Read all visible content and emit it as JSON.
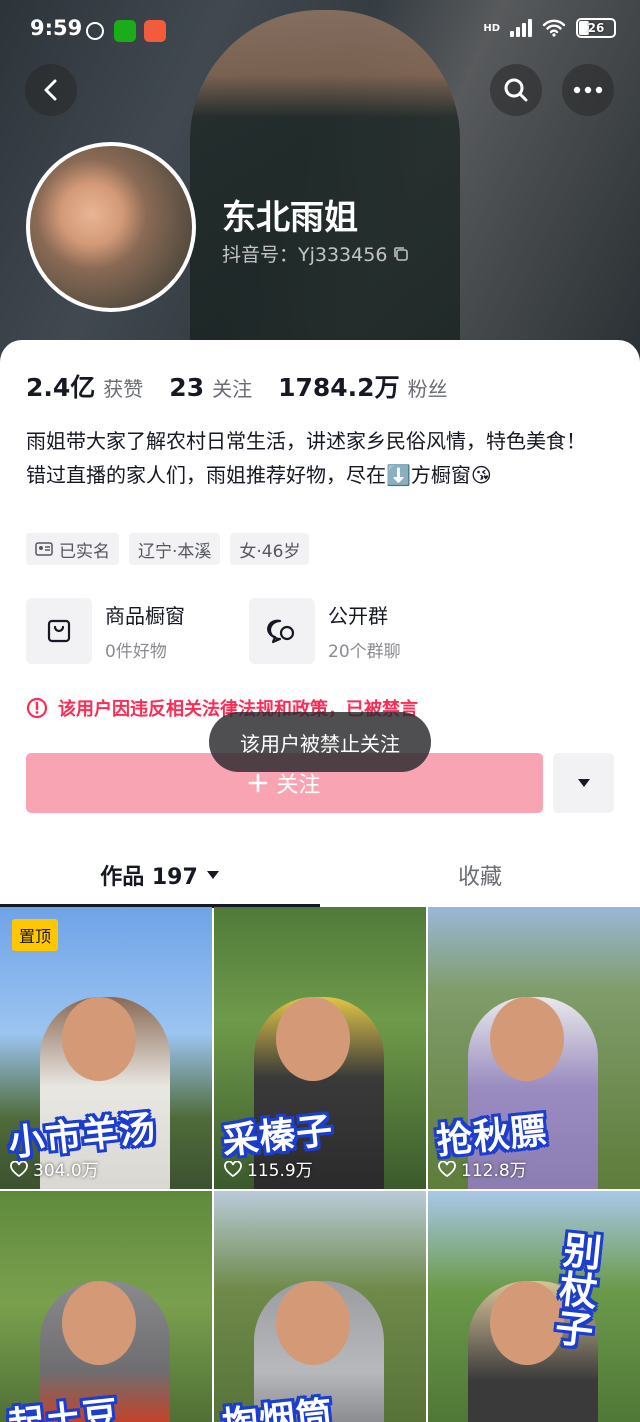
{
  "status_bar": {
    "time": "9:59",
    "network": "HD",
    "battery": "26"
  },
  "profile": {
    "name": "东北雨姐",
    "douyin_id": "抖音号：Yj333456",
    "stats": [
      {
        "value": "2.4亿",
        "label": "获赞"
      },
      {
        "value": "23",
        "label": "关注"
      },
      {
        "value": "1784.2万",
        "label": "粉丝"
      }
    ],
    "bio_line1": "雨姐带大家了解农村日常生活，讲述家乡民俗风情，特色美食！",
    "bio_line2": "错过直播的家人们，雨姐推荐好物，尽在⬇️方橱窗😘",
    "tags": [
      "已实名",
      "辽宁·本溪",
      "女·46岁"
    ]
  },
  "cards": [
    {
      "title": "商品橱窗",
      "sub": "0件好物",
      "icon": "shopping-bag-icon"
    },
    {
      "title": "公开群",
      "sub": "20个群聊",
      "icon": "group-chat-icon"
    }
  ],
  "warning": "该用户因违反相关法律法规和政策，已被禁言",
  "follow_label": "关注",
  "toast": "该用户被禁止关注",
  "tabs": {
    "works": "作品 197",
    "favorites": "收藏"
  },
  "videos": [
    {
      "title": "小市羊汤",
      "likes": "304.0万",
      "pinned": true,
      "pin_label": "置顶"
    },
    {
      "title": "采榛子",
      "likes": "115.9万"
    },
    {
      "title": "抢秋膘",
      "likes": "112.8万"
    },
    {
      "title": "起土豆",
      "likes": ""
    },
    {
      "title": "掏烟筒",
      "likes": ""
    },
    {
      "title": "别杖子",
      "likes": ""
    }
  ],
  "colors": {
    "accent": "#fe2c55",
    "follow_disabled": "#f9a4b2",
    "cover_text_outline": "#1c3ecf",
    "pin": "#ffc700"
  }
}
